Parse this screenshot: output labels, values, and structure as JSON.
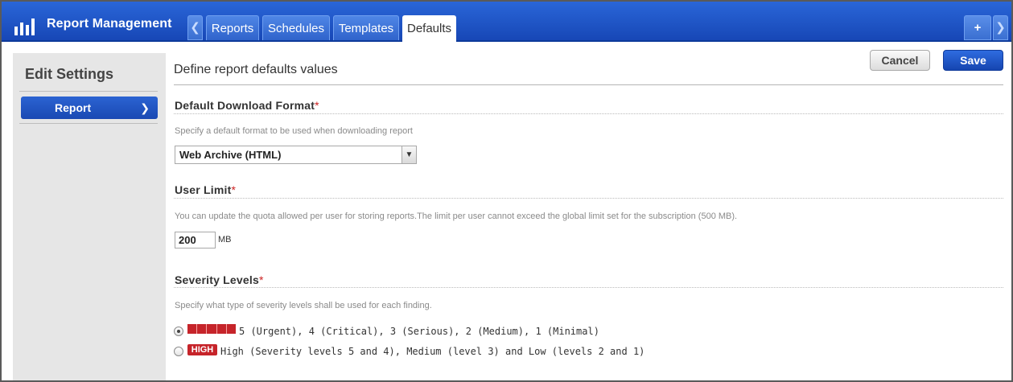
{
  "header": {
    "app_title": "Report Management",
    "tabs": [
      {
        "label": "Reports",
        "active": false
      },
      {
        "label": "Schedules",
        "active": false
      },
      {
        "label": "Templates",
        "active": false
      },
      {
        "label": "Defaults",
        "active": true
      }
    ],
    "add_label": "+",
    "prev_arrow": "❮",
    "next_arrow": "❯"
  },
  "sidebar": {
    "title": "Edit Settings",
    "items": [
      {
        "label": "Report",
        "active": true
      }
    ]
  },
  "main": {
    "title": "Define report defaults values",
    "cancel_label": "Cancel",
    "save_label": "Save"
  },
  "download_format": {
    "title": "Default Download Format",
    "required_mark": "*",
    "hint": "Specify a default format to be used when downloading report",
    "selected": "Web Archive (HTML)"
  },
  "user_limit": {
    "title": "User Limit",
    "required_mark": "*",
    "hint": "You can update the quota allowed per user for storing reports.The limit per user cannot exceed the global limit set for the subscription (500 MB).",
    "value": "200",
    "unit": "MB"
  },
  "severity": {
    "title": "Severity Levels",
    "required_mark": "*",
    "hint": "Specify what type of severity levels shall be used for each finding.",
    "options": [
      {
        "label": "5 (Urgent), 4 (Critical), 3 (Serious), 2 (Medium), 1 (Minimal)",
        "checked": true
      },
      {
        "badge": "HIGH",
        "label": "High (Severity levels 5 and 4), Medium (level 3) and Low (levels 2 and 1)",
        "checked": false
      }
    ]
  },
  "colors": {
    "header_blue": "#1f56c8",
    "severity_red": "#c6242a",
    "required_red": "#cc2222"
  }
}
